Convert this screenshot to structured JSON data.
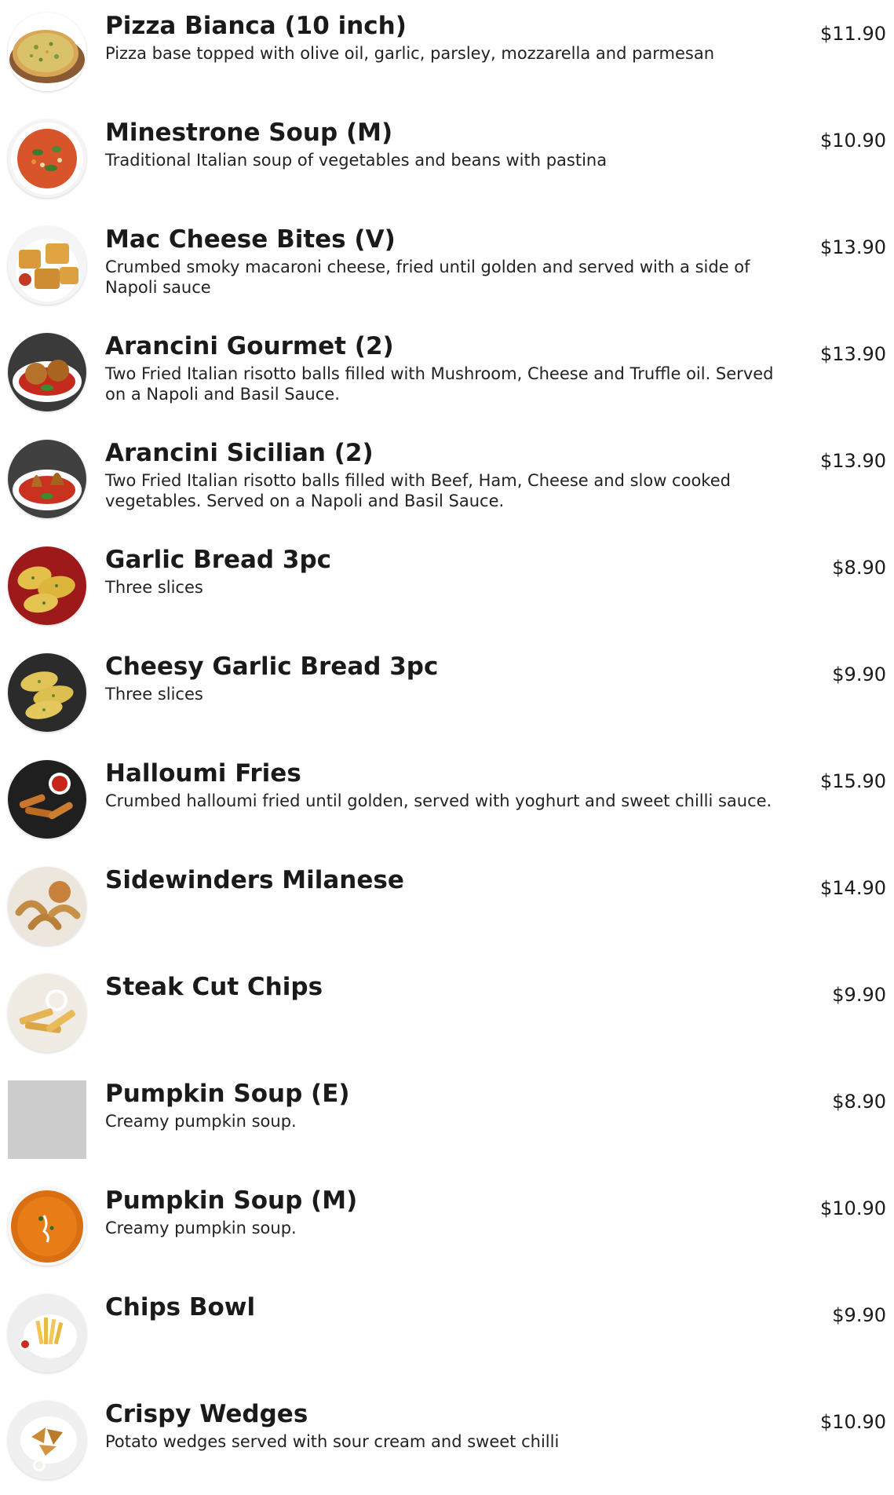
{
  "menu": {
    "items": [
      {
        "name": "Pizza Bianca (10 inch)",
        "description": "Pizza base topped with olive oil, garlic, parsley, mozzarella and parmesan",
        "price": "$11.90",
        "image": "pizza-bianca-photo"
      },
      {
        "name": "Minestrone Soup (M)",
        "description": "Traditional Italian soup of vegetables and beans with pastina",
        "price": "$10.90",
        "image": "minestrone-soup-photo"
      },
      {
        "name": "Mac Cheese Bites (V)",
        "description": "Crumbed smoky macaroni cheese, fried until golden and served with a side of Napoli sauce",
        "price": "$13.90",
        "image": "mac-cheese-bites-photo"
      },
      {
        "name": "Arancini Gourmet (2)",
        "description": "Two Fried Italian risotto balls filled with Mushroom, Cheese and Truffle oil. Served on a Napoli and Basil Sauce.",
        "price": "$13.90",
        "image": "arancini-gourmet-photo"
      },
      {
        "name": "Arancini Sicilian (2)",
        "description": "Two Fried Italian risotto balls filled with Beef, Ham, Cheese and slow cooked vegetables. Served on a Napoli and Basil Sauce.",
        "price": "$13.90",
        "image": "arancini-sicilian-photo"
      },
      {
        "name": "Garlic Bread 3pc",
        "description": "Three slices",
        "price": "$8.90",
        "image": "garlic-bread-photo"
      },
      {
        "name": "Cheesy Garlic Bread 3pc",
        "description": "Three slices",
        "price": "$9.90",
        "image": "cheesy-garlic-bread-photo"
      },
      {
        "name": "Halloumi Fries",
        "description": "Crumbed halloumi fried until golden, served with yoghurt and sweet chilli sauce.",
        "price": "$15.90",
        "image": "halloumi-fries-photo"
      },
      {
        "name": "Sidewinders Milanese",
        "description": "",
        "price": "$14.90",
        "image": "sidewinders-photo"
      },
      {
        "name": "Steak Cut Chips",
        "description": "",
        "price": "$9.90",
        "image": "steak-cut-chips-photo"
      },
      {
        "name": "Pumpkin Soup (E)",
        "description": "Creamy pumpkin soup.",
        "price": "$8.90",
        "image": "image-placeholder"
      },
      {
        "name": "Pumpkin Soup (M)",
        "description": "Creamy pumpkin soup.",
        "price": "$10.90",
        "image": "pumpkin-soup-photo"
      },
      {
        "name": "Chips Bowl",
        "description": "",
        "price": "$9.90",
        "image": "chips-bowl-photo"
      },
      {
        "name": "Crispy Wedges",
        "description": "Potato wedges served with sour cream and sweet chilli",
        "price": "$10.90",
        "image": "crispy-wedges-photo"
      }
    ]
  },
  "colors": {
    "text": "#1a1a1a",
    "placeholder": "#cccccc",
    "background": "#ffffff"
  }
}
